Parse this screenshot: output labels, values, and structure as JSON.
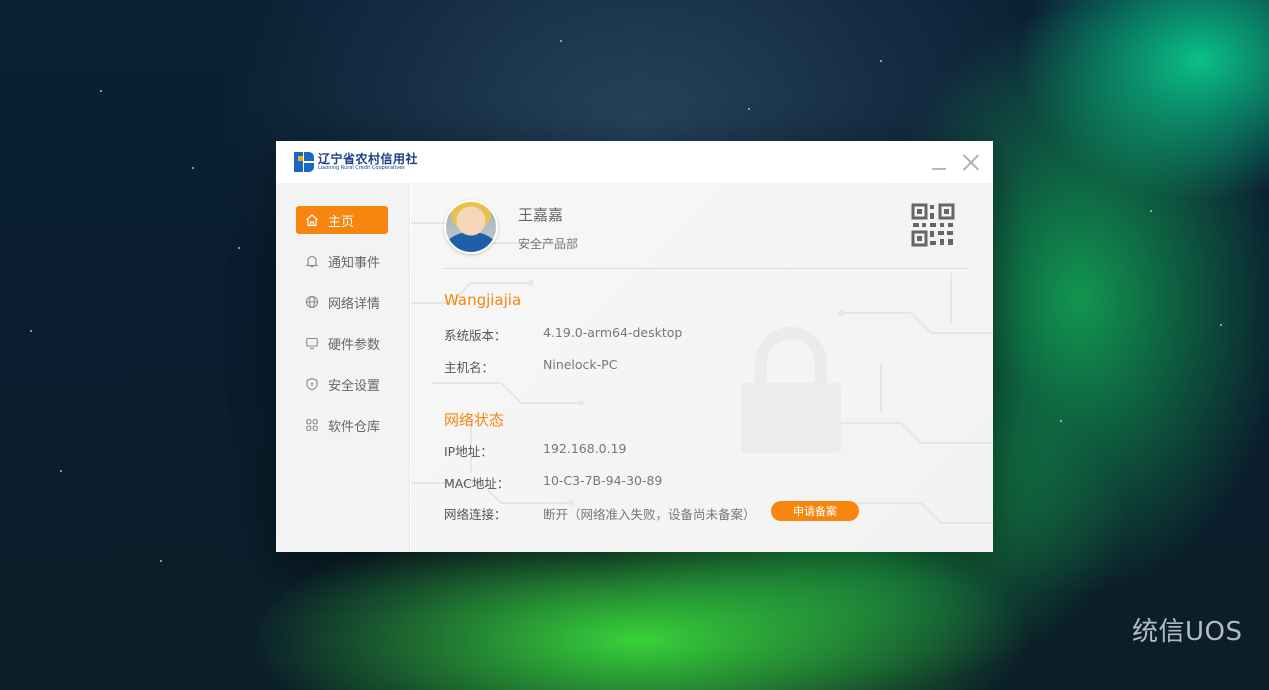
{
  "desktop": {
    "watermark": "统信UOS"
  },
  "app": {
    "logo_cn": "辽宁省农村信用社",
    "logo_en": "Liaoning Rural Credit Cooperatives"
  },
  "sidebar": {
    "items": [
      {
        "label": "主页",
        "icon": "home-icon",
        "active": true
      },
      {
        "label": "通知事件",
        "icon": "bell-icon",
        "active": false
      },
      {
        "label": "网络详情",
        "icon": "globe-icon",
        "active": false
      },
      {
        "label": "硬件参数",
        "icon": "monitor-icon",
        "active": false
      },
      {
        "label": "安全设置",
        "icon": "shield-icon",
        "active": false
      },
      {
        "label": "软件仓库",
        "icon": "grid-icon",
        "active": false
      }
    ]
  },
  "user": {
    "name": "王嘉嘉",
    "department": "安全产品部"
  },
  "system": {
    "title": "Wangjiajia",
    "version_label": "系统版本：",
    "version_value": "4.19.0-arm64-desktop",
    "hostname_label": "主机名：",
    "hostname_value": "Ninelock-PC"
  },
  "network": {
    "title": "网络状态",
    "ip_label": "IP地址：",
    "ip_value": "192.168.0.19",
    "mac_label": "MAC地址：",
    "mac_value": "10-C3-7B-94-30-89",
    "conn_label": "网络连接：",
    "conn_value": "断开（网络准入失败，设备尚未备案）",
    "apply_label": "申请备案"
  },
  "colors": {
    "accent": "#f6860f",
    "brand": "#1a67c7"
  }
}
